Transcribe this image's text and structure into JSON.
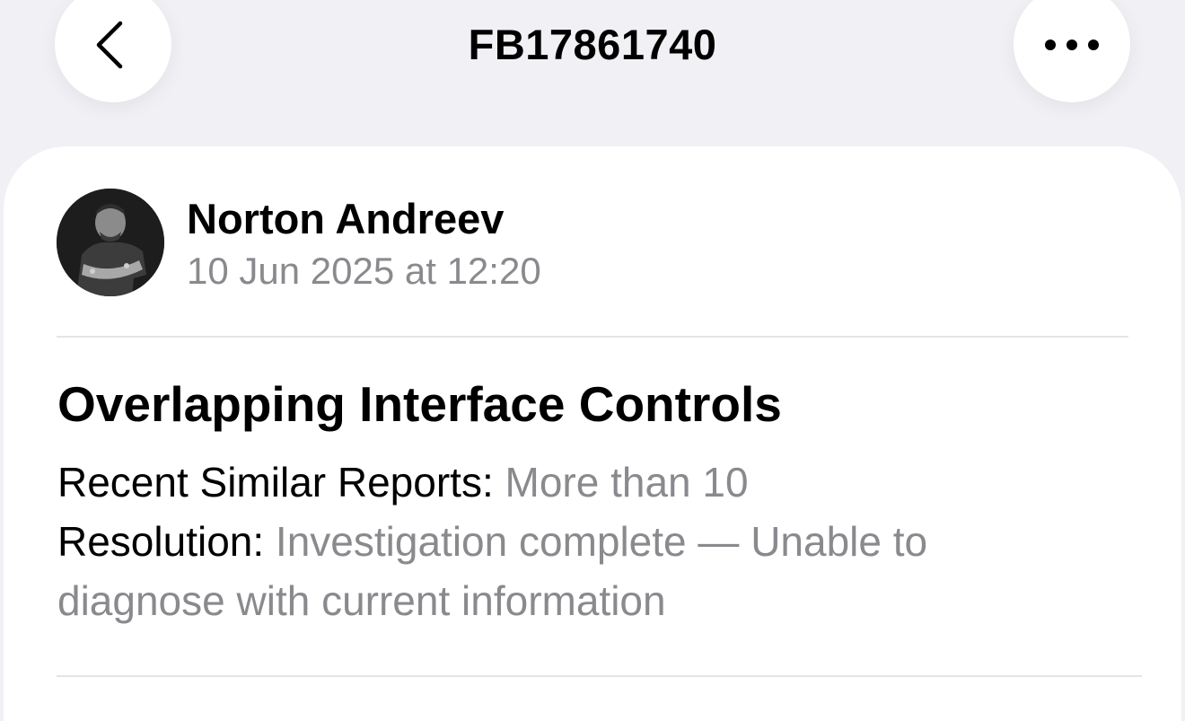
{
  "nav": {
    "title": "FB17861740",
    "back_icon": "chevron-left-icon",
    "more_icon": "ellipsis-icon"
  },
  "author": {
    "name": "Norton Andreev",
    "date": "10 Jun 2025 at 12:20"
  },
  "report": {
    "title": "Overlapping Interface Controls",
    "similar_label": "Recent Similar Reports:",
    "similar_value": "More than 10",
    "resolution_label": "Resolution:",
    "resolution_value": "Investigation complete — Unable to diagnose with current information"
  },
  "colors": {
    "background": "#f0f0f5",
    "card": "#ffffff",
    "primary_text": "#000000",
    "secondary_text": "#8a8a8e"
  }
}
